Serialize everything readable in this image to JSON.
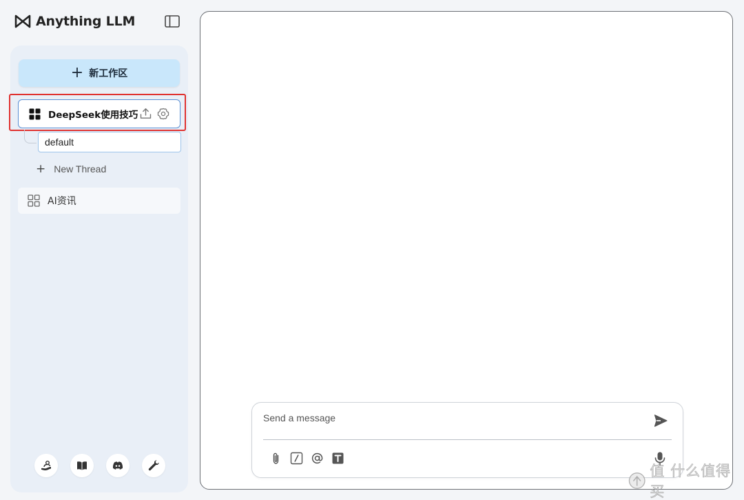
{
  "app": {
    "title": "Anything LLM"
  },
  "sidebar": {
    "new_workspace_label": "新工作区",
    "workspaces": [
      {
        "name": "DeepSeek使用技巧",
        "active": true
      },
      {
        "name": "AI资讯",
        "active": false
      }
    ],
    "threads": [
      {
        "name": "default"
      }
    ],
    "new_thread_label": "New Thread",
    "footer_icons": [
      "community-hub-icon",
      "docs-book-icon",
      "discord-icon",
      "settings-wrench-icon"
    ]
  },
  "composer": {
    "placeholder": "Send a message",
    "tools": [
      "paperclip-icon",
      "slash-command-icon",
      "at-mention-icon",
      "text-size-icon"
    ]
  },
  "watermark": {
    "text": "值 什么值得买"
  },
  "colors": {
    "accent_button": "#c9e7fb",
    "sidebar_bg": "#e9eff7",
    "highlight_red": "#e0312f",
    "active_border": "#5b8fd4"
  }
}
